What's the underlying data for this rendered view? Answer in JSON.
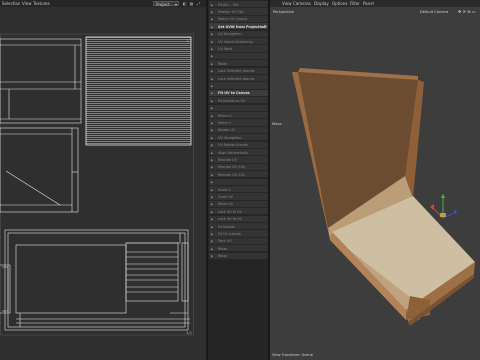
{
  "uv_editor": {
    "menu": [
      "Selection",
      "View",
      "Textures"
    ],
    "mode": "Project",
    "labels": {
      "top_right": "1,1",
      "bottom_right": "1,0"
    }
  },
  "tools": {
    "items": [
      {
        "label": "Fit Ally - Set",
        "header": false
      },
      {
        "label": "Realign UV Flip",
        "header": false
      },
      {
        "label": "Match UV Layout",
        "header": false
      },
      {
        "label": "Set UVW from Projection",
        "header": true,
        "gear": true
      },
      {
        "label": "UV Straighten",
        "header": false
      },
      {
        "label": "UV Island Stretching",
        "header": false
      },
      {
        "label": "UV Weld",
        "header": false
      },
      {
        "label": "",
        "header": false
      },
      {
        "label": "Relax",
        "header": false
      },
      {
        "label": "Lock Selected Islands",
        "header": false
      },
      {
        "label": "Lock Selected Islands",
        "header": false
      },
      {
        "label": "",
        "header": false
      },
      {
        "label": "Fit UV to Canvas",
        "header": true
      },
      {
        "label": "Fit Islands to UV",
        "header": false
      },
      {
        "label": "",
        "header": false
      },
      {
        "label": "Mirror U",
        "header": false
      },
      {
        "label": "Mirror V",
        "header": false
      },
      {
        "label": "Rotate UV",
        "header": false
      },
      {
        "label": "UV Straighten",
        "header": false
      },
      {
        "label": "UV Rotate Islands",
        "header": false
      },
      {
        "label": "Align Horizontally",
        "header": false
      },
      {
        "label": "Rescale UV",
        "header": false
      },
      {
        "label": "Rescale UV (UV)",
        "header": false
      },
      {
        "label": "Rescale UV (UV)",
        "header": false
      },
      {
        "label": "",
        "header": false
      },
      {
        "label": "Scale U",
        "header": false
      },
      {
        "label": "Scale UV",
        "header": false
      },
      {
        "label": "Move UV",
        "header": false
      },
      {
        "label": "Lock UV to UV",
        "header": false
      },
      {
        "label": "Lock UV to UV",
        "header": false
      },
      {
        "label": "Fit Islands",
        "header": false
      },
      {
        "label": "Fit UV Islands",
        "header": false
      },
      {
        "label": "Pack UV",
        "header": false
      },
      {
        "label": "Relax",
        "header": false
      },
      {
        "label": "Relax",
        "header": false
      }
    ]
  },
  "viewport": {
    "menu": [
      "View",
      "Cameras",
      "Display",
      "Options",
      "Filter",
      "Panel"
    ],
    "view_name": "Perspective",
    "camera": "Default Camera",
    "side_label": "Move",
    "bottom_label": "View Transform: Scene"
  },
  "colors": {
    "cardboard": "#ad7f50",
    "axis_x": "#e04040",
    "axis_y": "#40c040",
    "axis_z": "#3060e0"
  }
}
